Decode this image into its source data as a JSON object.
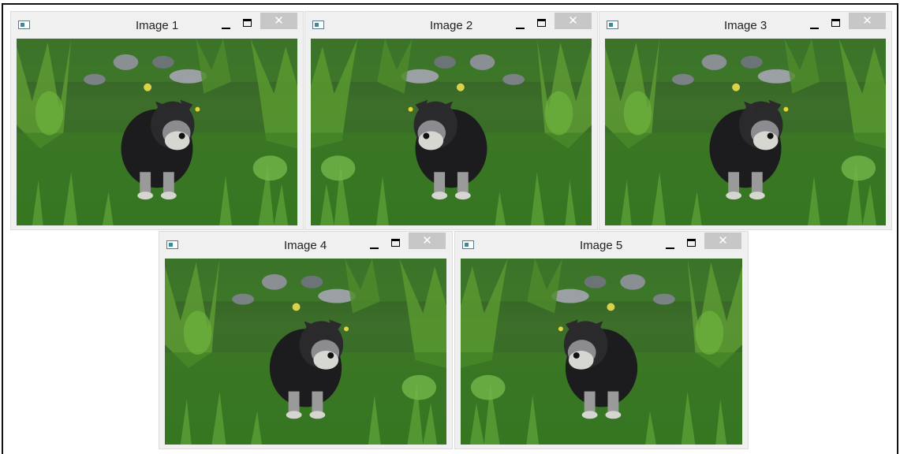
{
  "windows": [
    {
      "title": "Image 1",
      "close_glyph": "✕",
      "flipped": false
    },
    {
      "title": "Image 2",
      "close_glyph": "✕",
      "flipped": true
    },
    {
      "title": "Image 3",
      "close_glyph": "✕",
      "flipped": false
    },
    {
      "title": "Image 4",
      "close_glyph": "✕",
      "flipped": false
    },
    {
      "title": "Image 5",
      "close_glyph": "✕",
      "flipped": true
    }
  ],
  "icons": {
    "app": "window-app-icon",
    "minimize": "minimize-icon",
    "maximize": "maximize-icon",
    "close": "close-icon"
  },
  "photo": {
    "subject": "dog-in-grass-photo"
  },
  "colors": {
    "titlebar": "#f0f0f0",
    "close_button": "#c7c7c7",
    "frame_border": "#111111"
  }
}
